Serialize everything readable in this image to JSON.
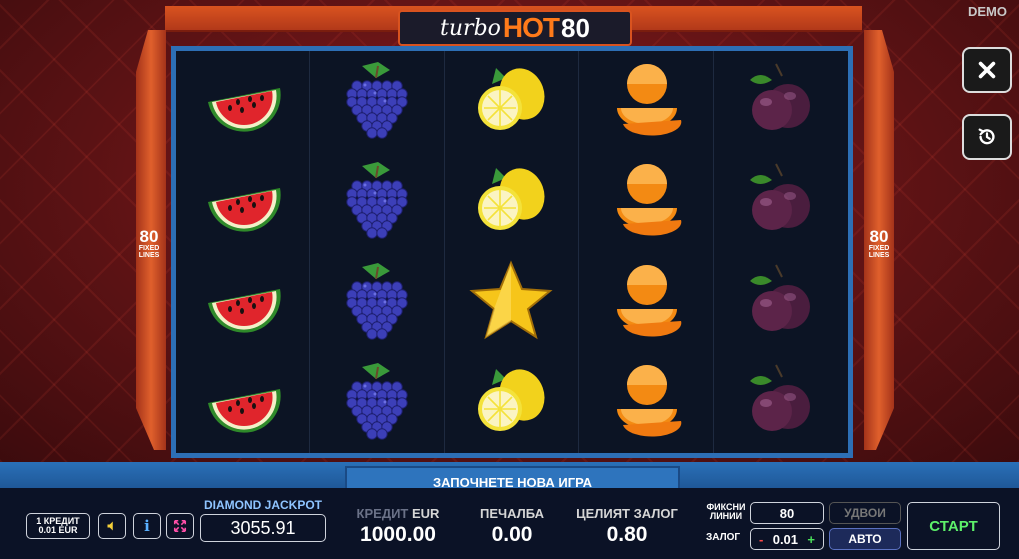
{
  "header": {
    "demo_label": "DEMO",
    "logo": {
      "part1": "turbo",
      "part2": "HOT",
      "part3": "80"
    }
  },
  "side_labels": {
    "number": "80",
    "text_line1": "FIXED",
    "text_line2": "LINES"
  },
  "reels": [
    [
      "watermelon",
      "grapes",
      "lemon",
      "orange",
      "plum"
    ],
    [
      "watermelon",
      "grapes",
      "lemon",
      "orange",
      "plum"
    ],
    [
      "watermelon",
      "grapes",
      "star",
      "orange",
      "plum"
    ],
    [
      "watermelon",
      "grapes",
      "lemon",
      "orange",
      "plum"
    ]
  ],
  "side_buttons": {
    "close_icon": "close-icon",
    "history_icon": "history-icon"
  },
  "new_game_label": "ЗАПОЧНЕТЕ НОВА ИГРА",
  "bottom": {
    "credit_line1": "1 КРЕДИТ",
    "credit_line2": "0.01 EUR",
    "jackpot_label": "DIAMOND JACKPOT",
    "jackpot_value": "3055.91",
    "credit_label": "КРЕДИТ",
    "credit_currency": "EUR",
    "credit_value": "1000.00",
    "win_label": "ПЕЧАЛБА",
    "win_value": "0.00",
    "total_bet_label": "ЦЕЛИЯТ ЗАЛОГ",
    "total_bet_value": "0.80",
    "fixed_lines_label_1": "ФИКСНИ",
    "fixed_lines_label_2": "ЛИНИИ",
    "fixed_lines_value": "80",
    "bet_label": "ЗАЛОГ",
    "bet_minus": "-",
    "bet_value": "0.01",
    "bet_plus": "+",
    "double_label": "УДВОИ",
    "auto_label": "АВТО",
    "start_label": "СТАРТ"
  },
  "colors": {
    "frame_blue": "#2d6fb5",
    "accent_orange": "#d9531f",
    "start_green": "#5df06a"
  }
}
